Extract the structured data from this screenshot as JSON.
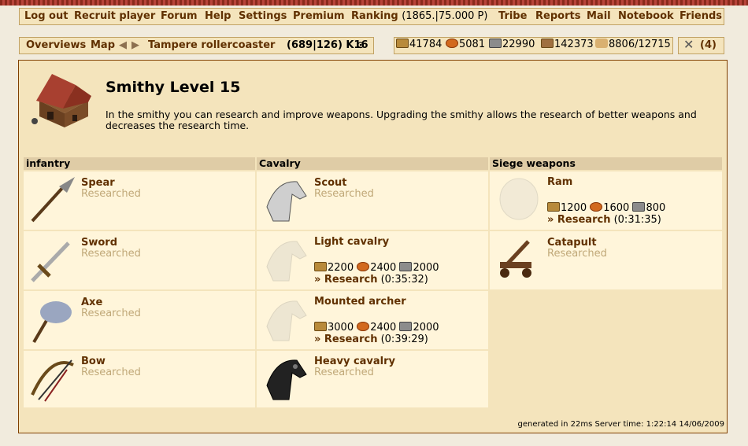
{
  "menu": {
    "logout": "Log out",
    "recruit": "Recruit player",
    "forum": "Forum",
    "help": "Help",
    "settings": "Settings",
    "premium": "Premium",
    "ranking": "Ranking",
    "ranking_value": "(1865.|75.000 P)",
    "tribe": "Tribe",
    "reports": "Reports",
    "mail": "Mail",
    "notebook": "Notebook",
    "friends": "Friends"
  },
  "nav": {
    "overviews": "Overviews",
    "map": "Map",
    "village": "Tampere rollercoaster",
    "coords": "(689|126) K16"
  },
  "resources": {
    "wood": "41784",
    "clay": "5081",
    "iron": "22990",
    "storage": "142373",
    "farm": "8806/12715",
    "attacks": "(4)"
  },
  "building": {
    "title": "Smithy Level 15",
    "description": "In the smithy you can research and improve weapons. Upgrading the smithy allows the research of better weapons and decreases the research time."
  },
  "columns": {
    "infantry": "infantry",
    "cavalry": "Cavalry",
    "siege": "Siege weapons"
  },
  "labels": {
    "researched": "Researched",
    "research_link": "» Research"
  },
  "units": {
    "spear": {
      "name": "Spear",
      "status": "Researched"
    },
    "sword": {
      "name": "Sword",
      "status": "Researched"
    },
    "axe": {
      "name": "Axe",
      "status": "Researched"
    },
    "bow": {
      "name": "Bow",
      "status": "Researched"
    },
    "scout": {
      "name": "Scout",
      "status": "Researched"
    },
    "light": {
      "name": "Light cavalry",
      "wood": "2200",
      "clay": "2400",
      "iron": "2000",
      "time": "(0:35:32)"
    },
    "marcher": {
      "name": "Mounted archer",
      "wood": "3000",
      "clay": "2400",
      "iron": "2000",
      "time": "(0:39:29)"
    },
    "heavy": {
      "name": "Heavy cavalry",
      "status": "Researched"
    },
    "ram": {
      "name": "Ram",
      "wood": "1200",
      "clay": "1600",
      "iron": "800",
      "time": "(0:31:35)"
    },
    "catapult": {
      "name": "Catapult",
      "status": "Researched"
    }
  },
  "footer": "generated in 22ms Server time: 1:22:14 14/06/2009"
}
